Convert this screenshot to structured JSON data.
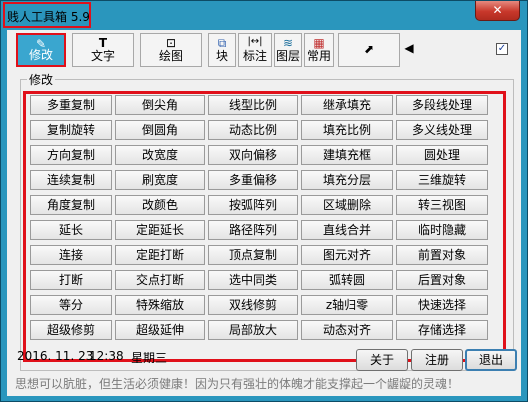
{
  "window": {
    "title": "贱人工具箱 5.9",
    "close_label": "✕"
  },
  "toolbar": {
    "items": [
      {
        "key": "modify",
        "label": "修改",
        "icon": "pencil-icon",
        "glyph": "✎"
      },
      {
        "key": "text",
        "label": "文字",
        "icon": "text-icon",
        "glyph": "T"
      },
      {
        "key": "draw",
        "label": "绘图",
        "icon": "draw-icon",
        "glyph": "⊡"
      },
      {
        "key": "block",
        "label": "块",
        "icon": "block-icon",
        "glyph": "⧉"
      },
      {
        "key": "dimension",
        "label": "标注",
        "icon": "dimension-icon",
        "glyph": "|↔|"
      },
      {
        "key": "layer",
        "label": "图层",
        "icon": "layers-icon",
        "glyph": "≋"
      },
      {
        "key": "common",
        "label": "常用",
        "icon": "grid-icon",
        "glyph": "▦"
      },
      {
        "key": "export",
        "label": "",
        "icon": "export-icon",
        "glyph": "⬈"
      },
      {
        "key": "arrow",
        "label": "",
        "icon": "arrow-left-icon",
        "glyph": "◀"
      }
    ],
    "checkbox_checked_glyph": "✓"
  },
  "group_label": "修改",
  "buttons": [
    [
      "多重复制",
      "倒尖角",
      "线型比例",
      "继承填充",
      "多段线处理"
    ],
    [
      "复制旋转",
      "倒圆角",
      "动态比例",
      "填充比例",
      "多义线处理"
    ],
    [
      "方向复制",
      "改宽度",
      "双向偏移",
      "建填充框",
      "圆处理"
    ],
    [
      "连续复制",
      "刷宽度",
      "多重偏移",
      "填充分层",
      "三维旋转"
    ],
    [
      "角度复制",
      "改颜色",
      "按弧阵列",
      "区域删除",
      "转三视图"
    ],
    [
      "延长",
      "定距延长",
      "路径阵列",
      "直线合并",
      "临时隐藏"
    ],
    [
      "连接",
      "定距打断",
      "顶点复制",
      "图元对齐",
      "前置对象"
    ],
    [
      "打断",
      "交点打断",
      "选中同类",
      "弧转圆",
      "后置对象"
    ],
    [
      "等分",
      "特殊缩放",
      "双线修剪",
      "z轴归零",
      "快速选择"
    ],
    [
      "超级修剪",
      "超级延伸",
      "局部放大",
      "动态对齐",
      "存储选择"
    ]
  ],
  "status": {
    "date": "2016. 11. 23",
    "time": "12:38",
    "weekday": "星期三"
  },
  "actions": {
    "about": "关于",
    "register": "注册",
    "exit": "退出"
  },
  "motto": "思想可以肮脏，但生活必须健康！因为只有强壮的体魄才能支撑起一个龌龊的灵魂！",
  "colors": {
    "frame": "#2a96bd",
    "highlight": "#e0101a",
    "active_tab": "#3aa6cf"
  }
}
